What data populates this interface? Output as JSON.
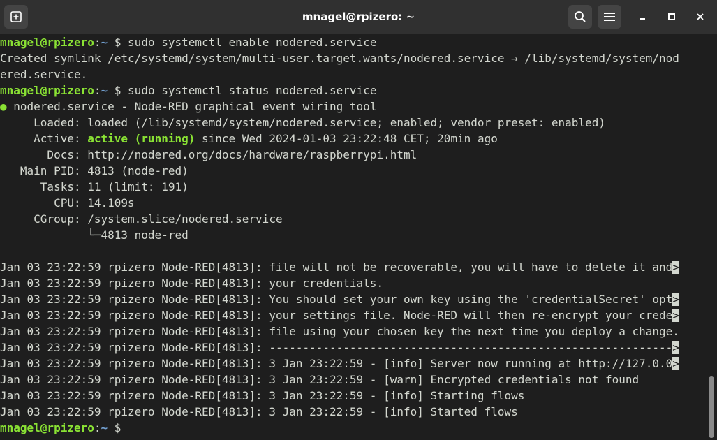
{
  "window": {
    "title": "mnagel@rpizero: ~"
  },
  "prompt": {
    "user_host": "mnagel@rpizero",
    "sep": ":",
    "path": "~",
    "symbol": " $ "
  },
  "lines": {
    "cmd1": "sudo systemctl enable nodered.service",
    "out1": "Created symlink /etc/systemd/system/multi-user.target.wants/nodered.service → /lib/systemd/system/nod",
    "out2": "ered.service.",
    "cmd2": "sudo systemctl status nodered.service",
    "status_bullet": "●",
    "status_title": " nodered.service - Node-RED graphical event wiring tool",
    "loaded": "     Loaded: loaded (/lib/systemd/system/nodered.service; enabled; vendor preset: enabled)",
    "active_label": "     Active: ",
    "active_state": "active (running)",
    "active_rest": " since Wed 2024-01-03 23:22:48 CET; 20min ago",
    "docs": "       Docs: http://nodered.org/docs/hardware/raspberrypi.html",
    "pid": "   Main PID: 4813 (node-red)",
    "tasks": "      Tasks: 11 (limit: 191)",
    "cpu": "        CPU: 14.109s",
    "cgroup": "     CGroup: /system.slice/nodered.service",
    "cgroup_child": "             └─4813 node-red",
    "trunc_marker": ">",
    "log1": "Jan 03 23:22:59 rpizero Node-RED[4813]: file will not be recoverable, you will have to delete it and",
    "log2": "Jan 03 23:22:59 rpizero Node-RED[4813]: your credentials.",
    "log3": "Jan 03 23:22:59 rpizero Node-RED[4813]: You should set your own key using the 'credentialSecret' opt",
    "log4": "Jan 03 23:22:59 rpizero Node-RED[4813]: your settings file. Node-RED will then re-encrypt your crede",
    "log5": "Jan 03 23:22:59 rpizero Node-RED[4813]: file using your chosen key the next time you deploy a change.",
    "log6": "Jan 03 23:22:59 rpizero Node-RED[4813]: ------------------------------------------------------------",
    "log7": "Jan 03 23:22:59 rpizero Node-RED[4813]: 3 Jan 23:22:59 - [info] Server now running at http://127.0.0",
    "log8": "Jan 03 23:22:59 rpizero Node-RED[4813]: 3 Jan 23:22:59 - [warn] Encrypted credentials not found",
    "log9": "Jan 03 23:22:59 rpizero Node-RED[4813]: 3 Jan 23:22:59 - [info] Starting flows",
    "log10": "Jan 03 23:22:59 rpizero Node-RED[4813]: 3 Jan 23:22:59 - [info] Started flows"
  },
  "colors": {
    "background": "#1e1e1e",
    "titlebar": "#303030",
    "prompt_user": "#8ae234",
    "prompt_path": "#729fcf",
    "text": "#d3d7cf"
  },
  "icons": {
    "new_tab": "new-tab-icon",
    "search": "search-icon",
    "menu": "hamburger-menu-icon",
    "minimize": "minimize-icon",
    "maximize": "maximize-icon",
    "close": "close-icon"
  }
}
